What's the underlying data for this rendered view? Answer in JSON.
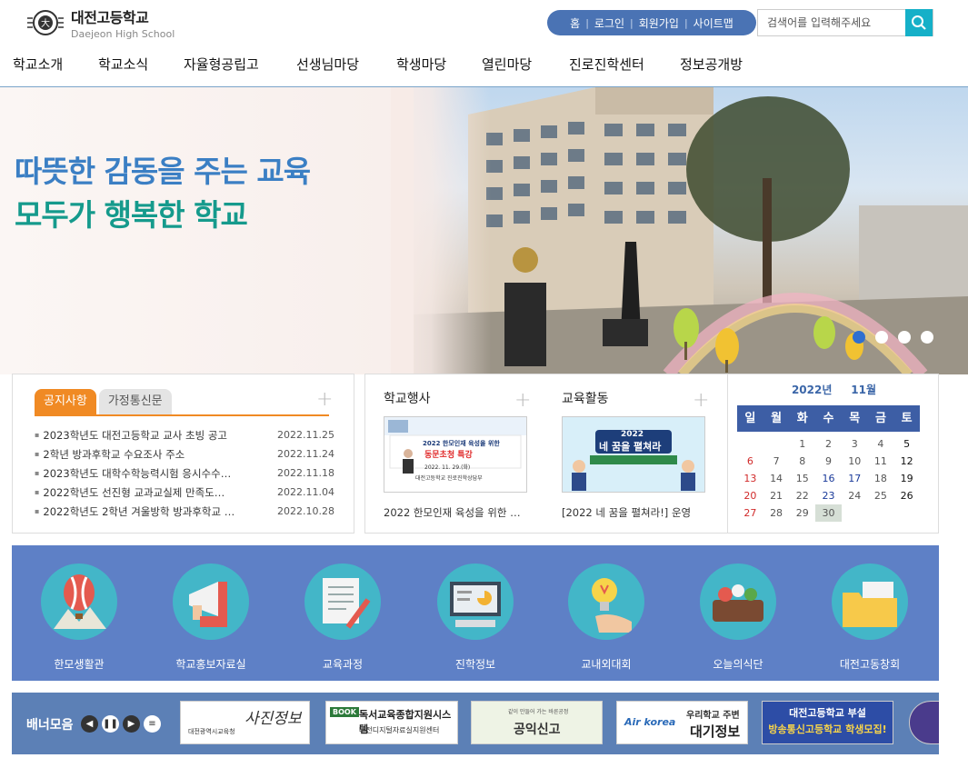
{
  "school": {
    "name_ko": "대전고등학교",
    "name_en": "Daejeon High School"
  },
  "util_links": [
    "홈",
    "로그인",
    "회원가입",
    "사이트맵"
  ],
  "search": {
    "placeholder": "검색어를 입력해주세요"
  },
  "gnb": [
    "학교소개",
    "학교소식",
    "자율형공립고",
    "선생님마당",
    "학생마당",
    "열린마당",
    "진로진학센터",
    "정보공개방"
  ],
  "hero": {
    "line1": "따뜻한 감동을 주는 교육",
    "line2": "모두가 행복한 학교",
    "slide_count": 4,
    "active_slide": 1
  },
  "notice": {
    "tabs": [
      "공지사항",
      "가정통신문"
    ],
    "items": [
      {
        "title": "2023학년도 대전고등학교 교사 초빙 공고",
        "date": "2022.11.25"
      },
      {
        "title": "2학년 방과후학교 수요조사 주소",
        "date": "2022.11.24"
      },
      {
        "title": "2023학년도 대학수학능력시험 응시수수…",
        "date": "2022.11.18"
      },
      {
        "title": "2022학년도 선진형 교과교실제 만족도…",
        "date": "2022.11.04"
      },
      {
        "title": "2022학년도 2학년 겨울방학 방과후학교 …",
        "date": "2022.10.28"
      }
    ]
  },
  "events": {
    "title": "학교행사",
    "caption": "2022 한모인재 육성을 위한 …",
    "thumb_lines": [
      "2022 한모인재 육성을 위한",
      "동문초청 특강",
      "2022. 11. 29.(화)",
      "대전고등학교 진로진학상담부"
    ]
  },
  "activities": {
    "title": "교육활동",
    "caption": "[2022 네 꿈을 펼쳐라!] 운영",
    "thumb_lines": [
      "2022",
      "네 꿈을 펼쳐라"
    ]
  },
  "calendar": {
    "year": "2022년",
    "month": "11월",
    "weekdays": [
      "일",
      "월",
      "화",
      "수",
      "목",
      "금",
      "토"
    ],
    "weeks": [
      [
        "",
        "",
        "1",
        "2",
        "3",
        "4",
        "5"
      ],
      [
        "6",
        "7",
        "8",
        "9",
        "10",
        "11",
        "12"
      ],
      [
        "13",
        "14",
        "15",
        "16",
        "17",
        "18",
        "19"
      ],
      [
        "20",
        "21",
        "22",
        "23",
        "24",
        "25",
        "26"
      ],
      [
        "27",
        "28",
        "29",
        "30",
        "",
        "",
        ""
      ]
    ],
    "today": "30"
  },
  "quick_menu": [
    "한모생활관",
    "학교홍보자료실",
    "교육과정",
    "진학정보",
    "교내외대회",
    "오늘의식단",
    "대전고동창회"
  ],
  "banner": {
    "title": "배너모음",
    "items": [
      {
        "text": "사진정보",
        "sub": "대전광역시교육청"
      },
      {
        "text": "독서교육종합지원시스템",
        "sub": "대전디지털자료실지원센터",
        "badge": "BOOK"
      },
      {
        "text": "공익신고",
        "sub": "같이 만들어 가는 바른공정"
      },
      {
        "text": "대기정보",
        "sub": "우리학교 주변",
        "brand": "Air korea"
      },
      {
        "text": "방송통신고등학교 학생모집!",
        "sub": "대전고등학교 부설"
      }
    ]
  },
  "colors": {
    "nav_blue": "#4a73b4",
    "teal": "#15b0c8",
    "orange_tab": "#f08a24",
    "quick_bg": "#5e80c6",
    "hero_blue": "#3b7fc4",
    "hero_green": "#159a8c"
  }
}
